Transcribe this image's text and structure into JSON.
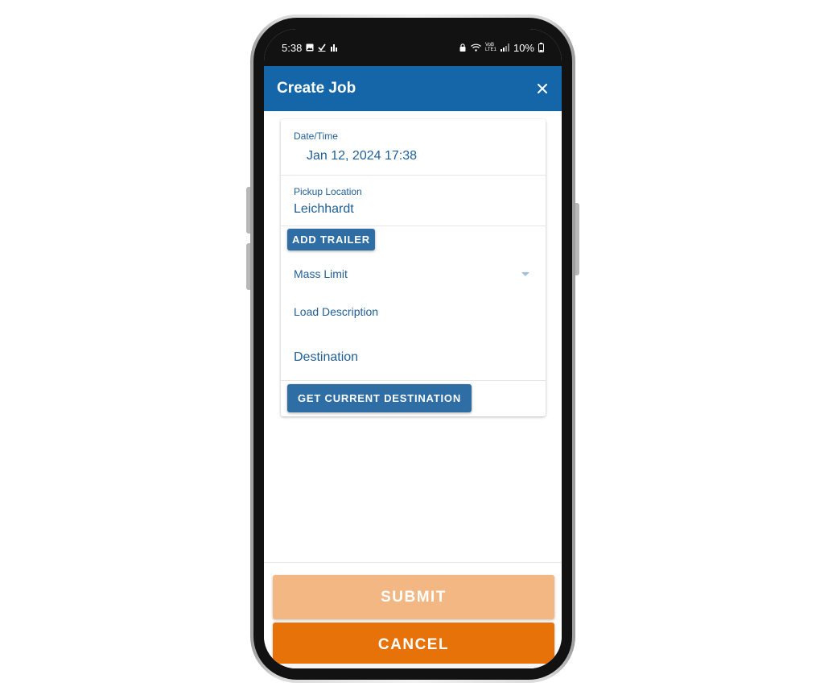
{
  "status_bar": {
    "time": "5:38",
    "network_label": "VoB LTE1",
    "battery": "10%"
  },
  "app_bar": {
    "title": "Create Job"
  },
  "form": {
    "date_time": {
      "label": "Date/Time",
      "value": "Jan 12, 2024 17:38"
    },
    "pickup_location": {
      "label": "Pickup Location",
      "value": "Leichhardt"
    },
    "add_trailer_label": "ADD TRAILER",
    "mass_limit_label": "Mass Limit",
    "load_description_label": "Load Description",
    "destination_label": "Destination",
    "get_current_destination_label": "GET CURRENT DESTINATION"
  },
  "footer": {
    "submit_label": "SUBMIT",
    "cancel_label": "CANCEL"
  },
  "colors": {
    "app_bar": "#1466a8",
    "primary_button": "#2f6ea5",
    "text_blue": "#1f5f95",
    "submit_disabled": "#f2b782",
    "cancel": "#e8720a"
  },
  "icons": {
    "status_left": [
      "image-icon",
      "check-icon",
      "bar-chart-icon"
    ],
    "status_right": [
      "lock-icon",
      "wifi-icon",
      "signal-icon",
      "battery-icon"
    ],
    "app_bar": "close-icon",
    "mass_limit": "dropdown-arrow-icon"
  }
}
